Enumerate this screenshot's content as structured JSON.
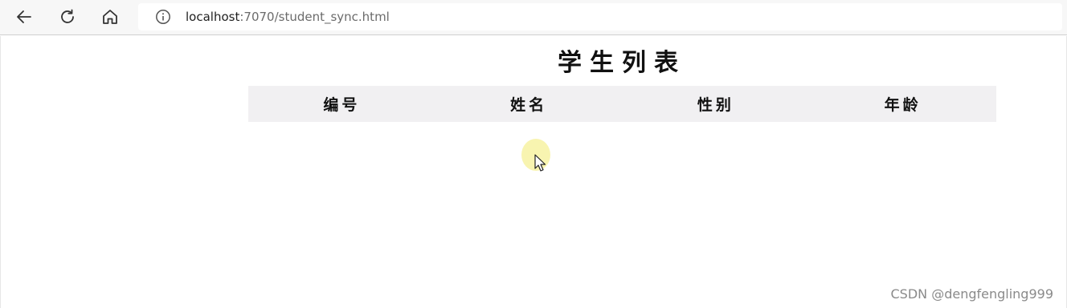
{
  "browser": {
    "url_host": "localhost",
    "url_path": ":7070/student_sync.html"
  },
  "page": {
    "title": "学生列表",
    "table": {
      "headers": [
        "编号",
        "姓名",
        "性别",
        "年龄"
      ],
      "rows": []
    }
  },
  "watermark": "CSDN @dengfengling999"
}
